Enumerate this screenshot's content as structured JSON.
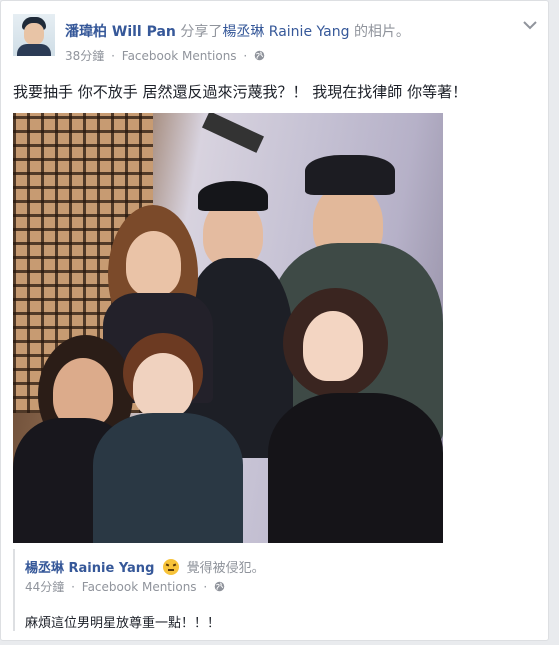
{
  "post": {
    "author": "潘瑋柏 Will Pan",
    "action": "分享了",
    "shared_from": "楊丞琳 Rainie Yang",
    "suffix": "的相片。",
    "time": "38分鐘",
    "separator": "·",
    "app": "Facebook Mentions",
    "separator2": "·",
    "privacy_icon": "globe-icon",
    "menu_icon": "chevron-down-icon",
    "text": "我要抽手 你不放手 居然還反過來污蔑我？！ 我現在找律師 你等著！"
  },
  "photo": {
    "content": "group-photo"
  },
  "shared": {
    "author": "楊丞琳 Rainie Yang",
    "feeling_icon": "angry-face-icon",
    "feeling": "覺得被侵犯。",
    "time": "44分鐘",
    "separator": "·",
    "app": "Facebook Mentions",
    "separator2": "·",
    "privacy_icon": "globe-icon",
    "text": "麻煩這位男明星放尊重一點！！！"
  },
  "colors": {
    "link": "#365899",
    "meta": "#90949c",
    "text": "#1d2129",
    "border": "#dddfe2"
  }
}
